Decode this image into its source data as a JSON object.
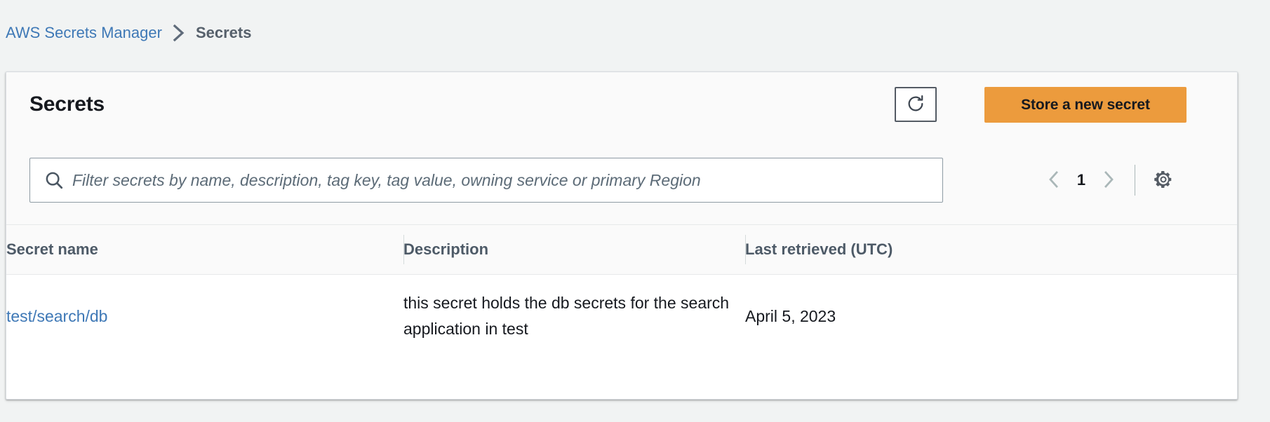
{
  "breadcrumb": {
    "root_label": "AWS Secrets Manager",
    "separator_icon": "chevron-right-icon",
    "current_label": "Secrets"
  },
  "panel": {
    "title": "Secrets",
    "refresh_icon": "refresh-icon",
    "store_button_label": "Store a new secret",
    "primary_color": "#ec9b3d",
    "link_color": "#3e78b6"
  },
  "search": {
    "icon": "search-icon",
    "value": "",
    "placeholder": "Filter secrets by name, description, tag key, tag value, owning service or primary Region"
  },
  "pagination": {
    "prev_icon": "chevron-left-icon",
    "page_number": "1",
    "next_icon": "chevron-right-icon",
    "settings_icon": "gear-icon"
  },
  "table": {
    "columns": [
      {
        "label": "Secret name"
      },
      {
        "label": "Description"
      },
      {
        "label": "Last retrieved (UTC)"
      }
    ],
    "rows": [
      {
        "secret_name": "test/search/db",
        "description": "this secret holds the db secrets for the search application in test",
        "last_retrieved": "April 5, 2023"
      }
    ]
  }
}
